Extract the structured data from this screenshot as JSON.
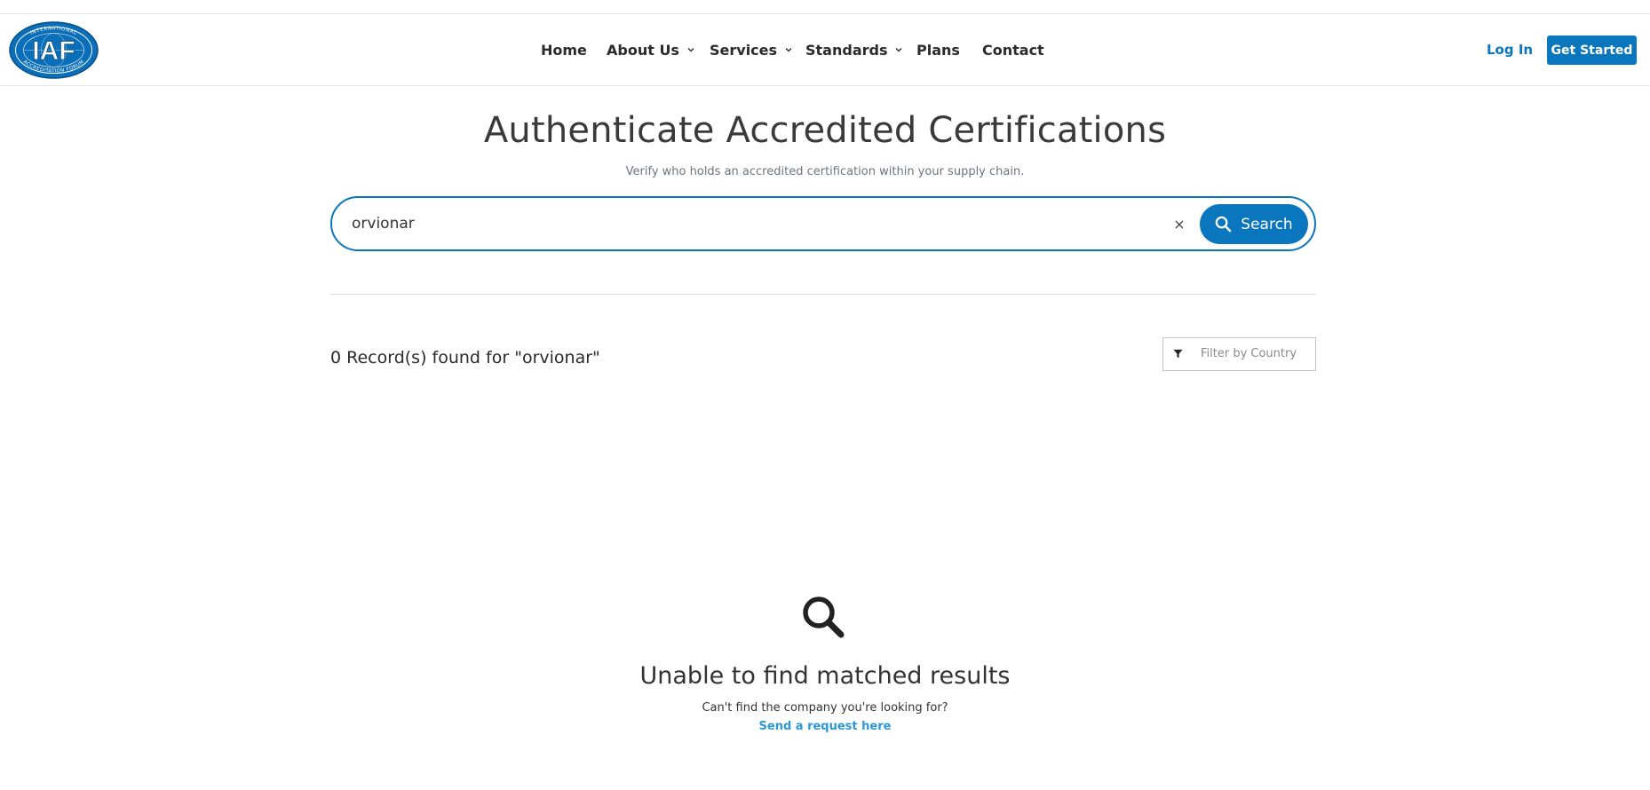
{
  "header": {
    "logo_text": "IAF",
    "logo_ring_text": "INTERNATIONAL ACCREDITATION FORUM",
    "nav": [
      {
        "label": "Home",
        "dropdown": false
      },
      {
        "label": "About Us",
        "dropdown": true
      },
      {
        "label": "Services",
        "dropdown": true
      },
      {
        "label": "Standards",
        "dropdown": true
      },
      {
        "label": "Plans",
        "dropdown": false
      },
      {
        "label": "Contact",
        "dropdown": false
      }
    ],
    "login_label": "Log In",
    "get_started_label": "Get Started"
  },
  "hero": {
    "title": "Authenticate Accredited Certifications",
    "subtitle": "Verify who holds an accredited certification within your supply chain."
  },
  "search": {
    "value": "orvionar",
    "clear_glyph": "×",
    "button_label": "Search",
    "icon": "search-icon"
  },
  "results": {
    "summary": "0 Record(s) found for \"orvionar\"",
    "filter_placeholder": "Filter by Country",
    "filter_icon": "filter-icon"
  },
  "empty_state": {
    "icon": "search-icon",
    "title": "Unable to find matched results",
    "text": "Can't find the company you're looking for?",
    "link_label": "Send a request here"
  },
  "colors": {
    "brand": "#0a76bd",
    "link": "#2c97d8",
    "text": "#333333"
  }
}
